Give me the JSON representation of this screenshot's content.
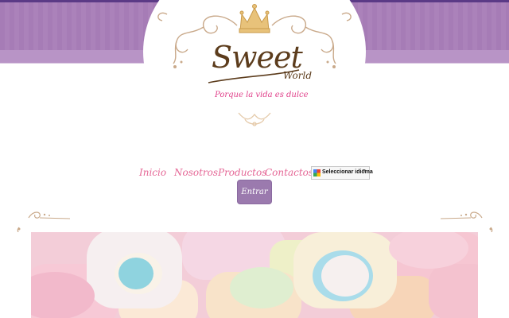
{
  "brand": {
    "name": "Sweet",
    "sub": "World",
    "tagline": "Porque la vida es dulce"
  },
  "nav": {
    "items": [
      {
        "label": "Inicio"
      },
      {
        "label": "Nosotros"
      },
      {
        "label": "Productos"
      },
      {
        "label": "Contactos"
      }
    ]
  },
  "language": {
    "label": "Seleccionar idioma",
    "arrow": "▼"
  },
  "enter_button": {
    "label": "Entrar"
  },
  "colors": {
    "banner": "#a67cb6",
    "nav_text": "#e56796",
    "button": "#9b7aae",
    "ornament": "#c9a98a"
  }
}
